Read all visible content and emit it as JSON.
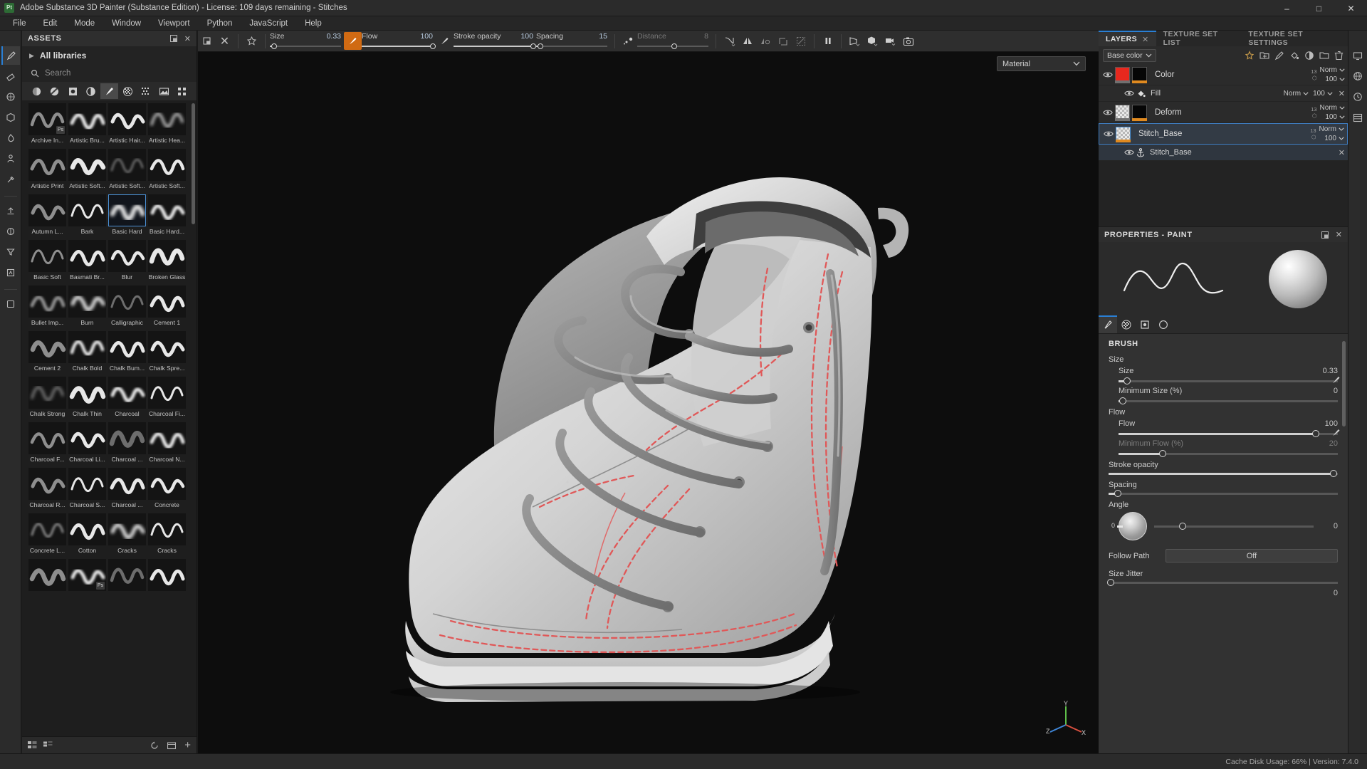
{
  "window": {
    "title": "Adobe Substance 3D Painter (Substance Edition) - License: 109 days remaining - Stitches",
    "logo_text": "Pt",
    "minimize": "–",
    "maximize": "□",
    "close": "✕"
  },
  "menubar": {
    "items": [
      "File",
      "Edit",
      "Mode",
      "Window",
      "Viewport",
      "Python",
      "JavaScript",
      "Help"
    ]
  },
  "assets": {
    "title": "ASSETS",
    "library": "All libraries",
    "search_placeholder": "Search",
    "search_value": "",
    "filters": [
      "materials-icon",
      "smart-materials-icon",
      "masks-icon",
      "smart-masks-icon",
      "brushes-icon",
      "alphas-icon",
      "textures-icon",
      "environments-icon",
      "grid-view-icon"
    ],
    "active_filter_index": 4,
    "selected_brush": "Basic Hard",
    "brushes": [
      {
        "label": "Archive In...",
        "badge": "Ps"
      },
      {
        "label": "Artistic Bru...",
        "badge": ""
      },
      {
        "label": "Artistic Hair...",
        "badge": ""
      },
      {
        "label": "Artistic Hea...",
        "badge": ""
      },
      {
        "label": "Artistic Print",
        "badge": ""
      },
      {
        "label": "Artistic Soft...",
        "badge": ""
      },
      {
        "label": "Artistic Soft...",
        "badge": ""
      },
      {
        "label": "Artistic Soft...",
        "badge": ""
      },
      {
        "label": "Autumn L...",
        "badge": ""
      },
      {
        "label": "Bark",
        "badge": ""
      },
      {
        "label": "Basic Hard",
        "badge": ""
      },
      {
        "label": "Basic Hard...",
        "badge": ""
      },
      {
        "label": "Basic Soft",
        "badge": ""
      },
      {
        "label": "Basmati Br...",
        "badge": ""
      },
      {
        "label": "Blur",
        "badge": ""
      },
      {
        "label": "Broken Glass",
        "badge": ""
      },
      {
        "label": "Bullet Imp...",
        "badge": ""
      },
      {
        "label": "Burn",
        "badge": ""
      },
      {
        "label": "Calligraphic",
        "badge": ""
      },
      {
        "label": "Cement 1",
        "badge": ""
      },
      {
        "label": "Cement 2",
        "badge": ""
      },
      {
        "label": "Chalk Bold",
        "badge": ""
      },
      {
        "label": "Chalk Bum...",
        "badge": ""
      },
      {
        "label": "Chalk Spre...",
        "badge": ""
      },
      {
        "label": "Chalk Strong",
        "badge": ""
      },
      {
        "label": "Chalk Thin",
        "badge": ""
      },
      {
        "label": "Charcoal",
        "badge": ""
      },
      {
        "label": "Charcoal Fi...",
        "badge": ""
      },
      {
        "label": "Charcoal F...",
        "badge": ""
      },
      {
        "label": "Charcoal Li...",
        "badge": ""
      },
      {
        "label": "Charcoal ...",
        "badge": ""
      },
      {
        "label": "Charcoal N...",
        "badge": ""
      },
      {
        "label": "Charcoal R...",
        "badge": ""
      },
      {
        "label": "Charcoal S...",
        "badge": ""
      },
      {
        "label": "Charcoal ...",
        "badge": ""
      },
      {
        "label": "Concrete",
        "badge": ""
      },
      {
        "label": "Concrete L...",
        "badge": ""
      },
      {
        "label": "Cotton",
        "badge": ""
      },
      {
        "label": "Cracks",
        "badge": ""
      },
      {
        "label": "Cracks",
        "badge": ""
      },
      {
        "label": "",
        "badge": ""
      },
      {
        "label": "",
        "badge": "Ps"
      },
      {
        "label": "",
        "badge": ""
      },
      {
        "label": "",
        "badge": ""
      }
    ]
  },
  "toolbar": {
    "size": {
      "label": "Size",
      "value": "0.33",
      "fill_pct": 6
    },
    "flow": {
      "label": "Flow",
      "value": "100",
      "fill_pct": 100
    },
    "stroke_opacity": {
      "label": "Stroke opacity",
      "value": "100",
      "fill_pct": 100
    },
    "spacing": {
      "label": "Spacing",
      "value": "15",
      "fill_pct": 6
    },
    "distance": {
      "label": "Distance",
      "value": "8",
      "fill_pct": 52
    },
    "icons": [
      "snapshot-icon",
      "clear-icon",
      "symmetry-icon",
      "brush-cursor-icon",
      "dots-icon",
      "falloff-icon",
      "mirror-icon",
      "mirror-alt-icon",
      "projection-icon",
      "fill-icon",
      "eraser-toggle-icon",
      "pause-icon",
      "camera-persp-icon",
      "cube-icon",
      "video-icon",
      "screenshot-icon"
    ]
  },
  "viewport": {
    "material_label": "Material",
    "axis": {
      "x": "X",
      "y": "Y",
      "z": "Z"
    }
  },
  "dock": {
    "tabs": [
      {
        "label": "LAYERS",
        "active": true,
        "closable": true
      },
      {
        "label": "TEXTURE SET LIST",
        "active": false,
        "closable": false
      },
      {
        "label": "TEXTURE SET SETTINGS",
        "active": false,
        "closable": false
      }
    ],
    "channel_select": "Base color",
    "toolbar_icons": [
      "effects-icon",
      "folder-add-icon",
      "paint-layer-icon",
      "fill-layer-icon",
      "mask-icon",
      "new-folder-icon",
      "delete-icon"
    ],
    "layers": [
      {
        "name": "Color",
        "type": "paint",
        "visible": true,
        "thumb": "red",
        "mask": "black",
        "channels": "13",
        "blend": "Norm",
        "opacity": "100",
        "selected": false,
        "children": [
          {
            "name": "Fill",
            "icon": "fill-bucket-icon",
            "visible": true,
            "blend": "Norm",
            "opacity": "100"
          }
        ]
      },
      {
        "name": "Deform",
        "type": "paint",
        "visible": true,
        "thumb": "checker",
        "mask": "black",
        "channels": "13",
        "blend": "Norm",
        "opacity": "100",
        "selected": false,
        "children": []
      },
      {
        "name": "Stitch_Base",
        "type": "paint",
        "visible": true,
        "thumb": "checker",
        "mask": "",
        "channels": "13",
        "blend": "Norm",
        "opacity": "100",
        "selected": true,
        "children": [
          {
            "name": "Stitch_Base",
            "icon": "anchor-icon",
            "visible": true,
            "blend": "",
            "opacity": ""
          }
        ]
      }
    ]
  },
  "properties": {
    "title": "PROPERTIES - PAINT",
    "tabs": [
      "brush-icon",
      "alpha-icon",
      "stencil-icon",
      "material-icon"
    ],
    "active_tab_index": 0,
    "section": "BRUSH",
    "groups": [
      {
        "title": "Size",
        "rows": [
          {
            "label": "Size",
            "value": "0.33",
            "fill_pct": 4,
            "dim": false,
            "pen": true
          },
          {
            "label": "Minimum Size (%)",
            "value": "0",
            "fill_pct": 2,
            "dim": false,
            "pen": false
          }
        ]
      },
      {
        "title": "Flow",
        "rows": [
          {
            "label": "Flow",
            "value": "100",
            "fill_pct": 90,
            "dim": false,
            "pen": true
          },
          {
            "label": "Minimum Flow (%)",
            "value": "20",
            "fill_pct": 20,
            "dim": true,
            "pen": false
          }
        ]
      }
    ],
    "stroke_opacity": {
      "label": "Stroke opacity",
      "value": "100",
      "fill_pct": 98
    },
    "spacing": {
      "label": "Spacing",
      "value": "15",
      "fill_pct": 4
    },
    "angle": {
      "label": "Angle",
      "value": "0",
      "dial_value": "0",
      "fill_pct": 18
    },
    "follow_path": {
      "label": "Follow Path",
      "value": "Off"
    },
    "size_jitter": {
      "label": "Size Jitter",
      "value": "0",
      "fill_pct": 1
    }
  },
  "statusbar": {
    "text": "Cache Disk Usage:  66% | Version: 7.4.0"
  }
}
